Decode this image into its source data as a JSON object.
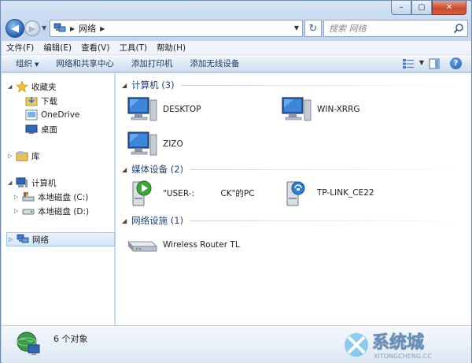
{
  "window": {
    "controls": {
      "minimize": "–",
      "maximize": "▢",
      "close": "✕"
    }
  },
  "address_bar": {
    "breadcrumb": "网络",
    "search_placeholder": "搜索 网络"
  },
  "menu": [
    "文件(F)",
    "编辑(E)",
    "查看(V)",
    "工具(T)",
    "帮助(H)"
  ],
  "toolbar": {
    "organize": "组织",
    "network_center": "网络和共享中心",
    "add_printer": "添加打印机",
    "add_wireless": "添加无线设备"
  },
  "nav": {
    "favorites": "收藏夹",
    "downloads": "下载",
    "onedrive": "OneDrive",
    "desktop": "桌面",
    "libraries": "库",
    "computer": "计算机",
    "disk_c": "本地磁盘 (C:)",
    "disk_d": "本地磁盘 (D:)",
    "network": "网络"
  },
  "groups": {
    "computers": {
      "title": "计算机 (3)",
      "items": [
        "DESKTOP",
        "WIN-XRRG",
        "ZIZO"
      ]
    },
    "media": {
      "title": "媒体设备 (2)",
      "items": [
        "\"USER-:          CK\"的PC",
        "TP-LINK_CE22"
      ]
    },
    "infrastructure": {
      "title": "网络设施 (1)",
      "items": [
        "Wireless Router TL"
      ]
    }
  },
  "status": {
    "count": "6 个对象"
  },
  "watermark": {
    "main": "系统城",
    "sub": "XITONGCHENG.CC"
  },
  "colors": {
    "group_heading": "#1e3f7a",
    "selection": "#d3e6f9",
    "accent": "#2a66b5"
  }
}
